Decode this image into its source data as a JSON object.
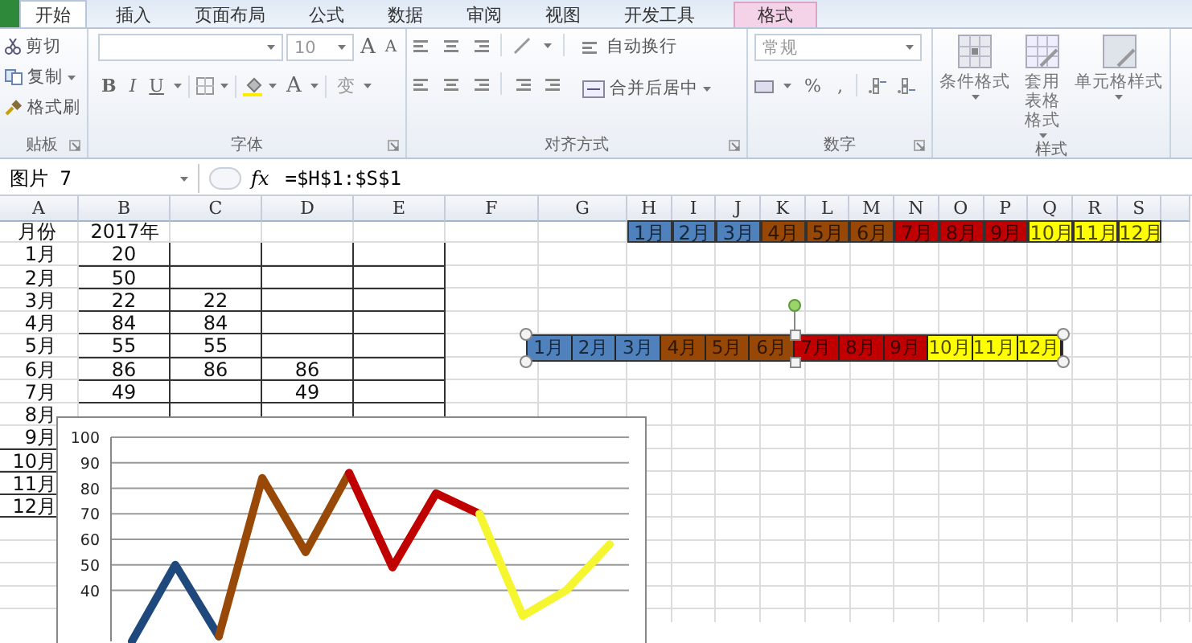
{
  "tabs": [
    {
      "kind": "file",
      "selected": false
    },
    {
      "label": "开始",
      "kind": "normal",
      "selected": true
    },
    {
      "label": "插入",
      "kind": "normal",
      "selected": false
    },
    {
      "label": "页面布局",
      "kind": "normal",
      "selected": false
    },
    {
      "label": "公式",
      "kind": "normal",
      "selected": false
    },
    {
      "label": "数据",
      "kind": "normal",
      "selected": false
    },
    {
      "label": "审阅",
      "kind": "normal",
      "selected": false
    },
    {
      "label": "视图",
      "kind": "normal",
      "selected": false
    },
    {
      "label": "开发工具",
      "kind": "normal",
      "selected": false
    },
    {
      "label": "格式",
      "kind": "contextual",
      "selected": false
    }
  ],
  "ribbon": {
    "groups": [
      {
        "kind": "clipboard",
        "label": "贴板",
        "items": [
          {
            "label": "剪切",
            "menu": false
          },
          {
            "label": "复制",
            "menu": true
          },
          {
            "label": "格式刷",
            "menu": false
          }
        ]
      },
      {
        "kind": "font",
        "label": "字体",
        "font_size": "10",
        "grow": "A",
        "shrink": "A",
        "bold": "B",
        "italic": "I",
        "underline": "U",
        "font_color": "A",
        "phonetic": "变"
      },
      {
        "kind": "alignment",
        "label": "对齐方式",
        "wrap": "自动换行",
        "merge": "合并后居中"
      },
      {
        "kind": "number",
        "label": "数字",
        "format": "常规",
        "percent": "%",
        "comma": ","
      },
      {
        "kind": "styles",
        "label": "样式",
        "items": [
          "条件格式",
          "套用表格格式",
          "单元格样式"
        ]
      }
    ]
  },
  "formula_bar": {
    "name_box": "图片 7",
    "fx": "fx",
    "formula": "=$H$1:$S$1"
  },
  "sheet": {
    "columns": [
      "A",
      "B",
      "C",
      "D",
      "E",
      "F",
      "G",
      "H",
      "I",
      "J",
      "K",
      "L",
      "M",
      "N",
      "O",
      "P",
      "Q",
      "R",
      "S"
    ],
    "rows": [
      {
        "A": "月份",
        "B": "2017年",
        "H": {
          "text": "1月",
          "color": "#4f81bd"
        },
        "I": {
          "text": "2月",
          "color": "#4f81bd"
        },
        "J": {
          "text": "3月",
          "color": "#4f81bd"
        },
        "K": {
          "text": "4月",
          "color": "#974806"
        },
        "L": {
          "text": "5月",
          "color": "#974806"
        },
        "M": {
          "text": "6月",
          "color": "#974806"
        },
        "N": {
          "text": "7月",
          "color": "#c00000"
        },
        "O": {
          "text": "8月",
          "color": "#c00000"
        },
        "P": {
          "text": "9月",
          "color": "#c00000"
        },
        "Q": {
          "text": "10月",
          "color": "#ffff00"
        },
        "R": {
          "text": "11月",
          "color": "#ffff00"
        },
        "S": {
          "text": "12月",
          "color": "#ffff00"
        }
      },
      {
        "A": "1月",
        "B": "20"
      },
      {
        "A": "2月",
        "B": "50"
      },
      {
        "A": "3月",
        "B": "22",
        "C": "22"
      },
      {
        "A": "4月",
        "B": "84",
        "C": "84"
      },
      {
        "A": "5月",
        "B": "55",
        "C": "55"
      },
      {
        "A": "6月",
        "B": "86",
        "C": "86",
        "D": "86"
      },
      {
        "A": "7月",
        "B": "49",
        "D": "49"
      },
      {
        "A": "8月"
      },
      {
        "A": "9月"
      },
      {
        "A": "10月"
      },
      {
        "A": "11月"
      },
      {
        "A": "12月"
      }
    ]
  },
  "linked_picture": {
    "selected": true,
    "segments": [
      {
        "color": "#4f81bd",
        "cells": [
          "1月",
          "2月",
          "3月"
        ]
      },
      {
        "color": "#974806",
        "cells": [
          "4月",
          "5月",
          "6月"
        ]
      },
      {
        "color": "#c00000",
        "cells": [
          "7月",
          "8月",
          "9月"
        ]
      },
      {
        "color": "#ffff00",
        "cells": [
          "10月",
          "11月",
          "12月"
        ]
      }
    ]
  },
  "chart": {
    "chart_data": {
      "type": "line",
      "ylim": [
        20,
        100
      ],
      "yticks": [
        {
          "value": 40,
          "label": "40"
        },
        {
          "value": 50,
          "label": "50"
        },
        {
          "value": 60,
          "label": "60"
        },
        {
          "value": 70,
          "label": "70"
        },
        {
          "value": 80,
          "label": "80"
        },
        {
          "value": 90,
          "label": "90"
        },
        {
          "value": 100,
          "label": "100"
        }
      ],
      "grid": true,
      "series": [
        {
          "color": "#1f497d",
          "values": [
            20,
            50,
            22,
            null,
            null,
            null,
            null,
            null,
            null,
            null,
            null,
            null
          ]
        },
        {
          "color": "#984807",
          "values": [
            null,
            null,
            22,
            84,
            55,
            86,
            null,
            null,
            null,
            null,
            null,
            null
          ]
        },
        {
          "color": "#c00000",
          "values": [
            null,
            null,
            null,
            null,
            null,
            86,
            49,
            78,
            70,
            null,
            null,
            null
          ]
        },
        {
          "color": "#f5f530",
          "values": [
            null,
            null,
            null,
            null,
            null,
            null,
            null,
            null,
            70,
            30,
            40,
            58
          ]
        }
      ]
    }
  }
}
